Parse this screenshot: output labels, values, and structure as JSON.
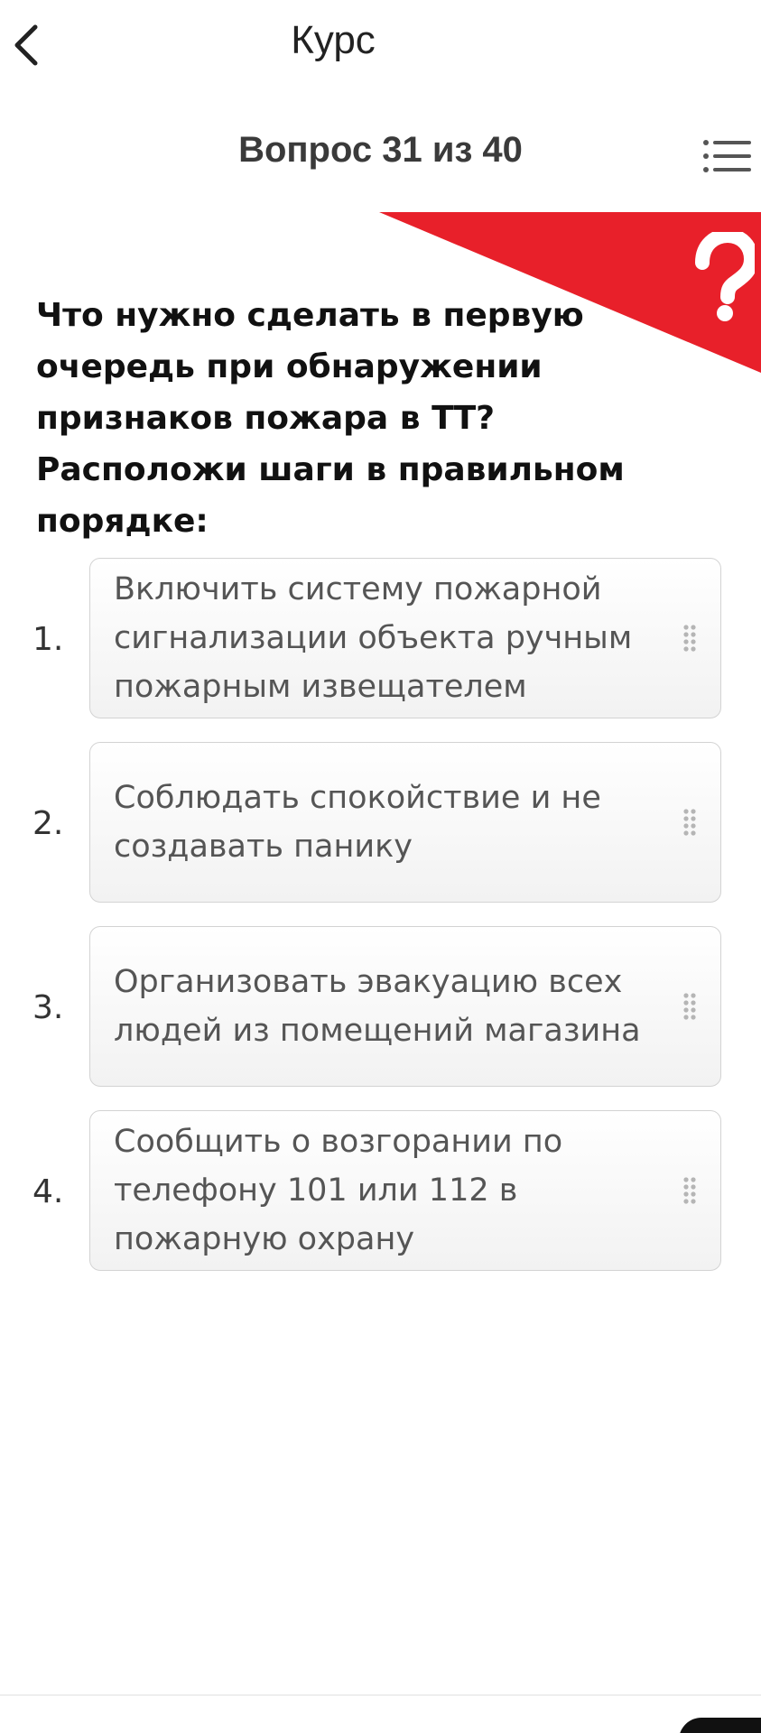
{
  "header": {
    "title": "Курс",
    "back_icon": "chevron-left-icon"
  },
  "question_header": {
    "counter": "Вопрос 31 из 40",
    "menu_icon": "list-menu-icon"
  },
  "banner": {
    "icon": "question-mark-icon",
    "accent_color": "#e8202a"
  },
  "question": {
    "text": "Что нужно сделать в первую очередь при обнаружении признаков пожара в ТТ? Расположи шаги в правильном порядке:"
  },
  "answers": [
    {
      "number": "1.",
      "text": "Включить систему пожарной сигнализации объекта ручным пожарным извещателем"
    },
    {
      "number": "2.",
      "text": "Соблюдать спокойствие и не создавать панику"
    },
    {
      "number": "3.",
      "text": "Организовать эвакуацию всех людей из помещений магазина"
    },
    {
      "number": "4.",
      "text": "Сообщить о возгорании по телефону 101 или 112 в пожарную охрану"
    }
  ]
}
